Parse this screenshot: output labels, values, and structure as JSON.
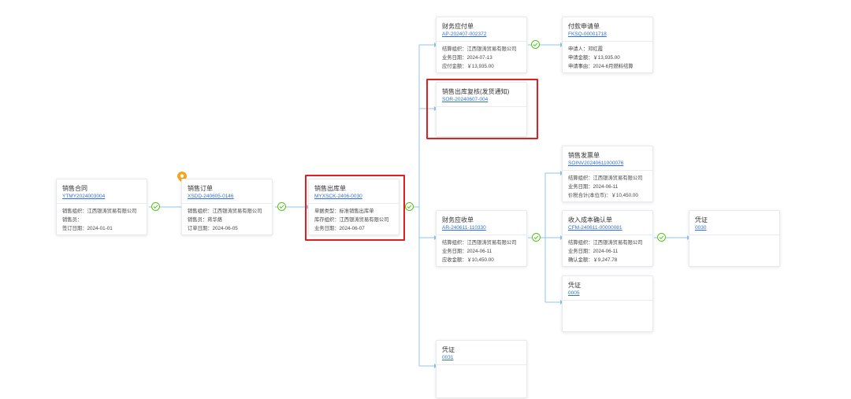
{
  "colors": {
    "accent_link": "#2f6fd6",
    "line": "#8fc3ef",
    "check": "#52c41a",
    "highlight": "#e02020",
    "pin": "#f7a21b"
  },
  "nodes": {
    "contract": {
      "title": "销售合同",
      "code": "YTMY2024003004",
      "fields": [
        "销售组织：江西银涛贸易有限公司",
        "销售员：",
        "签订日期：2024-01-01"
      ]
    },
    "order": {
      "title": "销售订单",
      "code": "XSDD-240605-0146",
      "fields": [
        "销售组织：江西银涛贸易有限公司",
        "销售员：蒋华烙",
        "订单日期：2024-06-05"
      ]
    },
    "outbound": {
      "title": "销售出库单",
      "code": "MYXSCK-2406-0030",
      "fields": [
        "单据类型：标准销售出库单",
        "库存组织：江西银涛贸易有限公司",
        "业务日期：2024-06-07"
      ]
    },
    "ap": {
      "title": "财务应付单",
      "code": "AP-202407-002372",
      "fields": [
        "结算组织：江西银涛贸易有限公司",
        "业务日期：2024-07-13",
        "应付金额：￥13,935.00"
      ]
    },
    "payment_request": {
      "title": "付款申请单",
      "code": "FKSQ-00001718",
      "fields": [
        "申请人：邓红霞",
        "申请金额：￥13,935.00",
        "申请事由：2024-6月燃料结算"
      ]
    },
    "review": {
      "title": "销售出库复核(发货通知)",
      "code": "SOR-20240607-004",
      "fields": []
    },
    "ar": {
      "title": "财务应收单",
      "code": "AR-240611-110330",
      "fields": [
        "结算组织：江西银涛贸易有限公司",
        "业务日期：2024-06-11",
        "应收金额：￥10,450.00"
      ]
    },
    "invoice": {
      "title": "销售发票单",
      "code": "SOINV20240611000076",
      "fields": [
        "结算组织：江西银涛贸易有限公司",
        "业务日期：2024-06-11",
        "价税合计(本位币)：￥10,450.00"
      ]
    },
    "revenue_cost": {
      "title": "收入成本确认单",
      "code": "CFM-240611-00000081",
      "fields": [
        "结算组织：江西银涛贸易有限公司",
        "业务日期：2024-06-11",
        "确认金额：￥9,247.78"
      ]
    },
    "voucher_0030": {
      "title": "凭证",
      "code": "0030",
      "fields": []
    },
    "voucher_0005": {
      "title": "凭证",
      "code": "0005",
      "fields": []
    },
    "voucher_0031": {
      "title": "凭证",
      "code": "0031",
      "fields": []
    }
  }
}
